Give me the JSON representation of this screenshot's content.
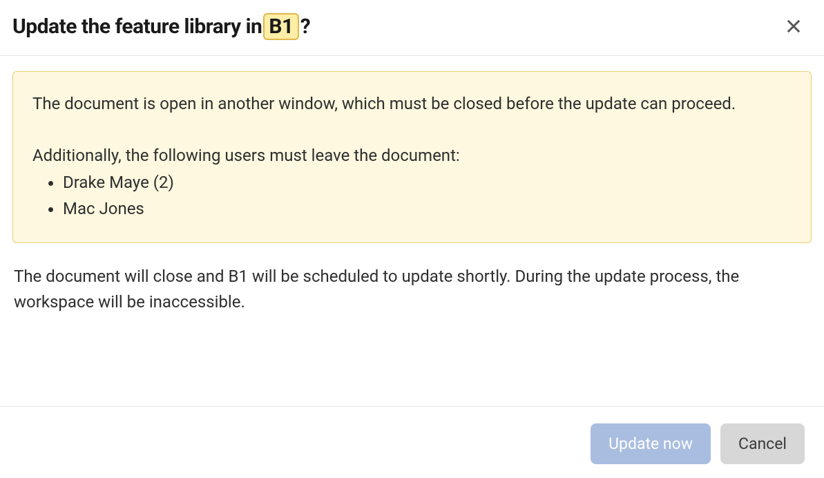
{
  "dialog": {
    "title_prefix": "Update the feature library in ",
    "title_badge": "B1",
    "title_suffix": "?",
    "warning": {
      "para1": "The document is open in another window, which must be closed before the update can proceed.",
      "list_intro": "Additionally, the following users must leave the document:",
      "users": [
        "Drake Maye (2)",
        "Mac Jones"
      ]
    },
    "body_text": "The document will close and B1 will be scheduled to update shortly. During the update process, the workspace will be inaccessible.",
    "buttons": {
      "primary": "Update now",
      "secondary": "Cancel"
    }
  },
  "colors": {
    "warning_bg": "#fdf8df",
    "warning_border": "#e9cf7a",
    "badge_bg": "#fdeea8",
    "badge_border": "#e0b84a",
    "primary_btn": "#a9bde0",
    "secondary_btn": "#d7d7d7"
  }
}
